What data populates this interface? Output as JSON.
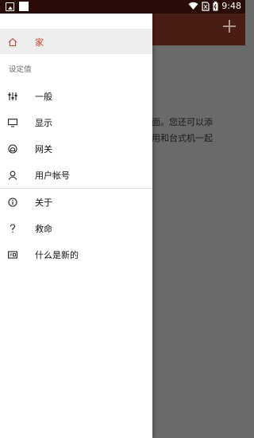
{
  "status_bar": {
    "time": "9:48",
    "icons": [
      "image-icon",
      "square-icon",
      "wifi-icon",
      "no-sim-icon",
      "battery-icon"
    ]
  },
  "app": {
    "bg_line_1": "桌面。您还可以添",
    "bg_line_2": "应用和台式机一起",
    "toolbar_plus": "add-icon"
  },
  "drawer": {
    "home_label": "家",
    "section_title": "设定值",
    "items": [
      {
        "label": "一般",
        "icon": "sliders-icon"
      },
      {
        "label": "显示",
        "icon": "monitor-icon"
      },
      {
        "label": "网关",
        "icon": "gateway-icon"
      },
      {
        "label": "用户帐号",
        "icon": "user-icon"
      },
      {
        "label": "关于",
        "icon": "info-icon"
      },
      {
        "label": "救命",
        "icon": "help-icon"
      },
      {
        "label": "什么是新的",
        "icon": "whats-new-icon"
      }
    ]
  },
  "colors": {
    "accent": "#c0452f",
    "toolbar": "#4a1d14",
    "status_bar": "#2a0c08",
    "scrim": "#6a6a6a"
  }
}
